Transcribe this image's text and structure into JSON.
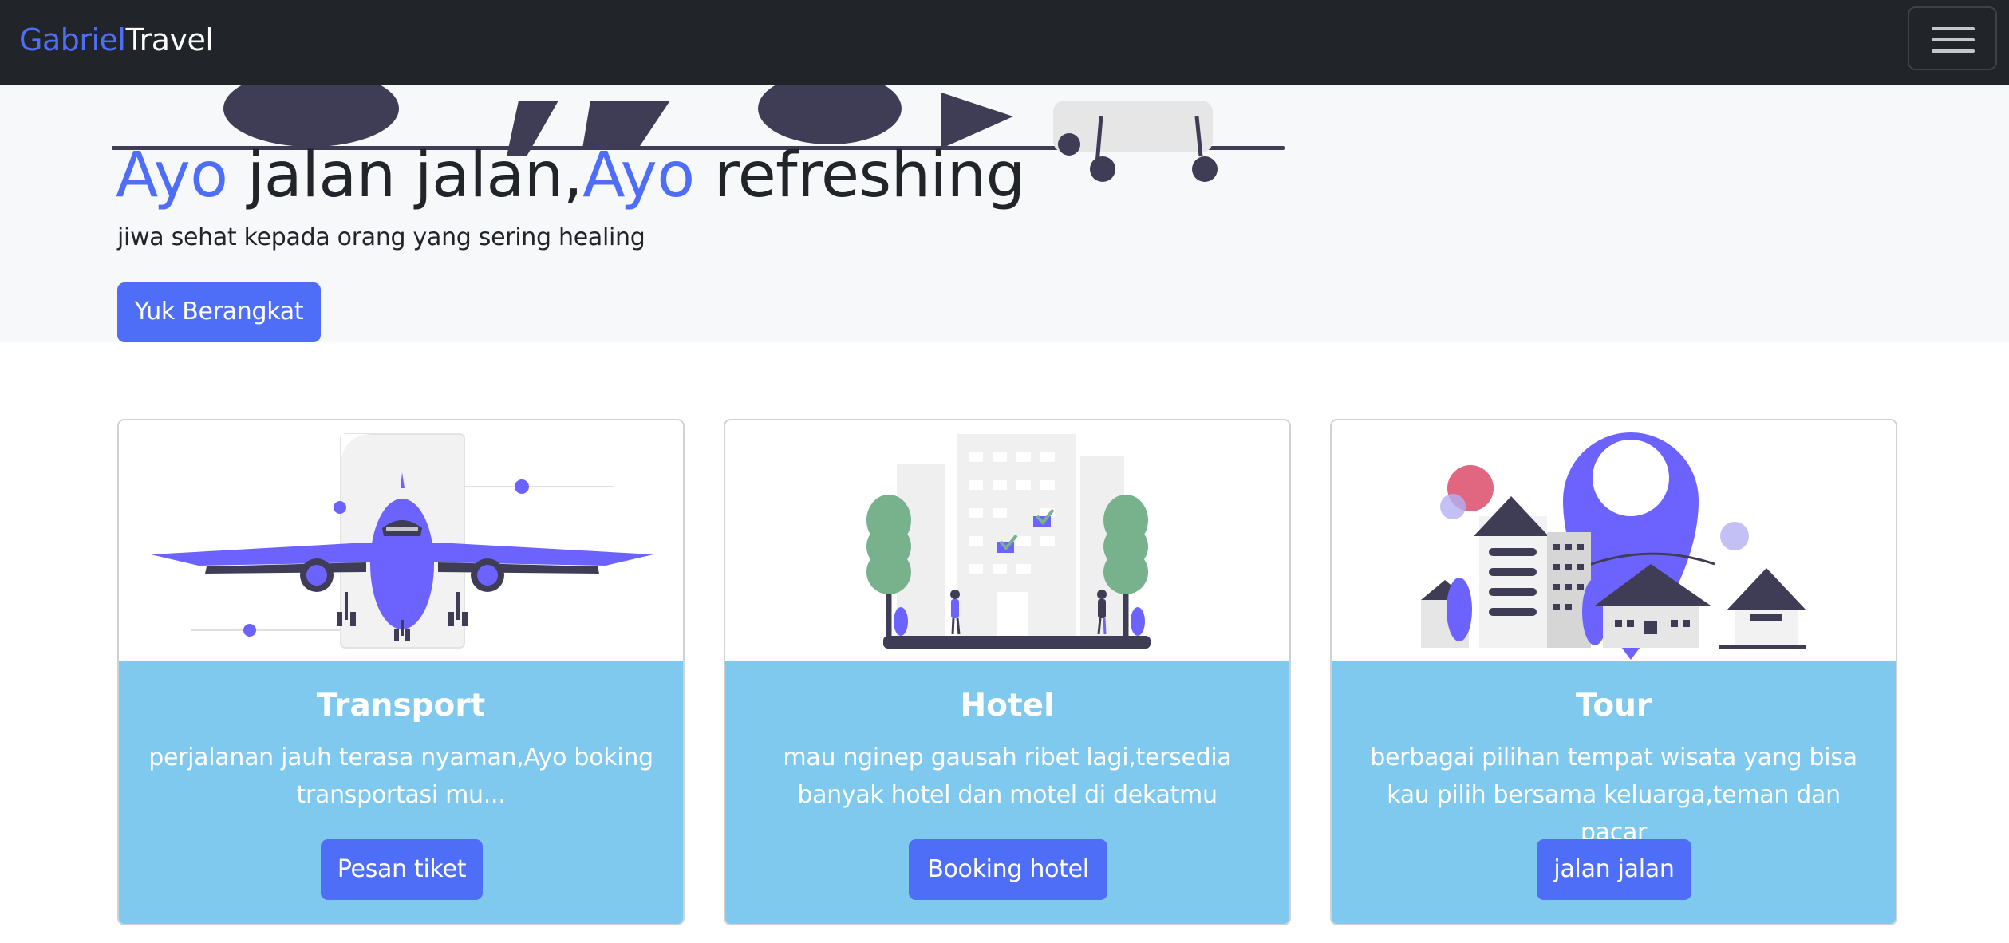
{
  "navbar": {
    "brand_part1": "Gabriel",
    "brand_part2": "Travel",
    "toggler_icon": "hamburger-menu-icon"
  },
  "hero": {
    "title_word1": "Ayo",
    "title_mid": " jalan jalan,",
    "title_word2": "Ayo",
    "title_end": " refreshing",
    "subtitle": "jiwa sehat kepada orang yang sering healing",
    "button_label": "Yuk Berangkat"
  },
  "cards": [
    {
      "title": "Transport",
      "text": "perjalanan jauh terasa nyaman,Ayo boking transportasi mu...",
      "button_label": "Pesan tiket",
      "illustration": "airplane-illustration"
    },
    {
      "title": "Hotel",
      "text": "mau nginep gausah ribet lagi,tersedia banyak hotel dan motel di dekatmu",
      "button_label": "Booking hotel",
      "illustration": "hotel-building-illustration"
    },
    {
      "title": "Tour",
      "text": "berbagai pilihan tempat wisata yang bisa kau pilih bersama keluarga,teman dan pacar",
      "button_label": "jalan jalan",
      "illustration": "map-pin-city-illustration"
    }
  ],
  "colors": {
    "accent": "#4f6ef7",
    "navbar_bg": "#212529",
    "hero_bg": "#f7f8fa",
    "card_body_bg": "#7fc9ef",
    "illustration_purple": "#6c63ff"
  }
}
